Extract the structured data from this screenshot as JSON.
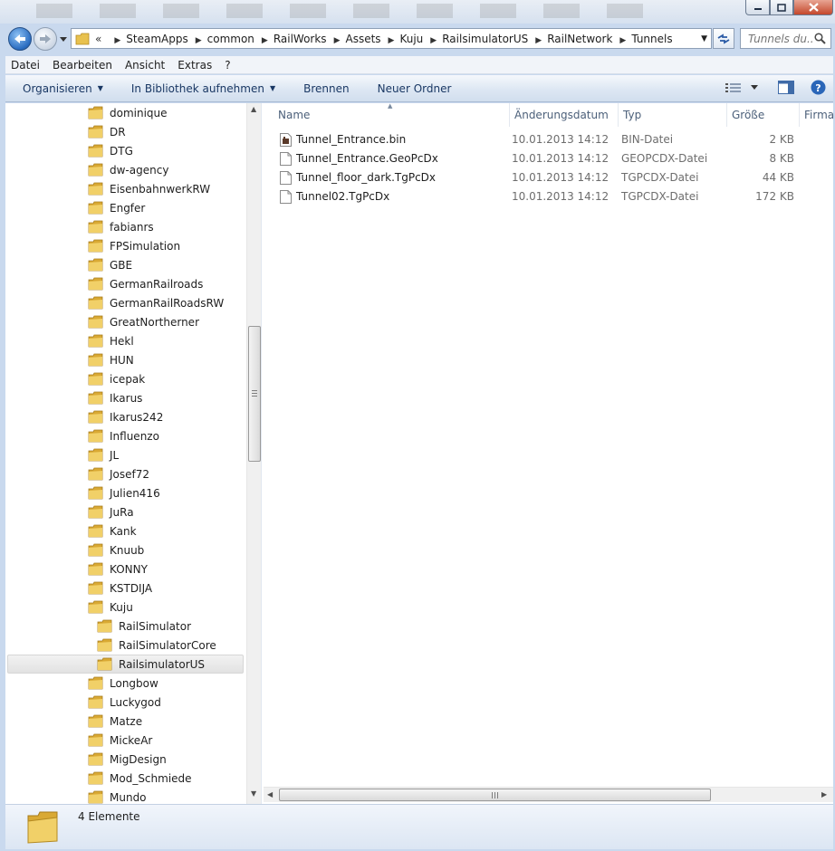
{
  "window": {
    "minimize_glyph": "—",
    "maximize_glyph": "□",
    "close_glyph": "✕"
  },
  "address": {
    "overflow": "«",
    "crumbs": [
      "SteamApps",
      "common",
      "RailWorks",
      "Assets",
      "Kuju",
      "RailsimulatorUS",
      "RailNetwork",
      "Tunnels"
    ],
    "chevron": "▶",
    "dropdown": "▼"
  },
  "search": {
    "placeholder": "Tunnels du..."
  },
  "menu": [
    "Datei",
    "Bearbeiten",
    "Ansicht",
    "Extras",
    "?"
  ],
  "commands": {
    "organize": "Organisieren",
    "library": "In Bibliothek aufnehmen",
    "burn": "Brennen",
    "new_folder": "Neuer Ordner",
    "caret": "▼"
  },
  "tree": [
    {
      "label": "dominique",
      "level": 0
    },
    {
      "label": "DR",
      "level": 0
    },
    {
      "label": "DTG",
      "level": 0
    },
    {
      "label": "dw-agency",
      "level": 0
    },
    {
      "label": "EisenbahnwerkRW",
      "level": 0
    },
    {
      "label": "Engfer",
      "level": 0
    },
    {
      "label": "fabianrs",
      "level": 0
    },
    {
      "label": "FPSimulation",
      "level": 0
    },
    {
      "label": "GBE",
      "level": 0
    },
    {
      "label": "GermanRailroads",
      "level": 0
    },
    {
      "label": "GermanRailRoadsRW",
      "level": 0
    },
    {
      "label": "GreatNortherner",
      "level": 0
    },
    {
      "label": "Hekl",
      "level": 0
    },
    {
      "label": "HUN",
      "level": 0
    },
    {
      "label": "icepak",
      "level": 0
    },
    {
      "label": "Ikarus",
      "level": 0
    },
    {
      "label": "Ikarus242",
      "level": 0
    },
    {
      "label": "Influenzo",
      "level": 0
    },
    {
      "label": "JL",
      "level": 0
    },
    {
      "label": "Josef72",
      "level": 0
    },
    {
      "label": "Julien416",
      "level": 0
    },
    {
      "label": "JuRa",
      "level": 0
    },
    {
      "label": "Kank",
      "level": 0
    },
    {
      "label": "Knuub",
      "level": 0
    },
    {
      "label": "KONNY",
      "level": 0
    },
    {
      "label": "KSTDIJA",
      "level": 0
    },
    {
      "label": "Kuju",
      "level": 0
    },
    {
      "label": "RailSimulator",
      "level": 1
    },
    {
      "label": "RailSimulatorCore",
      "level": 1
    },
    {
      "label": "RailsimulatorUS",
      "level": 1,
      "selected": true
    },
    {
      "label": "Longbow",
      "level": 0
    },
    {
      "label": "Luckygod",
      "level": 0
    },
    {
      "label": "Matze",
      "level": 0
    },
    {
      "label": "MickeAr",
      "level": 0
    },
    {
      "label": "MigDesign",
      "level": 0
    },
    {
      "label": "Mod_Schmiede",
      "level": 0
    },
    {
      "label": "Mundo",
      "level": 0
    }
  ],
  "columns": {
    "name": "Name",
    "date": "Änderungsdatum",
    "type": "Typ",
    "size": "Größe",
    "company": "Firma",
    "sort_glyph": "▲"
  },
  "files": [
    {
      "name": "Tunnel_Entrance.bin",
      "date": "10.01.2013 14:12",
      "type": "BIN-Datei",
      "size": "2 KB",
      "icon": "binary-file-icon"
    },
    {
      "name": "Tunnel_Entrance.GeoPcDx",
      "date": "10.01.2013 14:12",
      "type": "GEOPCDX-Datei",
      "size": "8 KB",
      "icon": "blank-file-icon"
    },
    {
      "name": "Tunnel_floor_dark.TgPcDx",
      "date": "10.01.2013 14:12",
      "type": "TGPCDX-Datei",
      "size": "44 KB",
      "icon": "blank-file-icon"
    },
    {
      "name": "Tunnel02.TgPcDx",
      "date": "10.01.2013 14:12",
      "type": "TGPCDX-Datei",
      "size": "172 KB",
      "icon": "blank-file-icon"
    }
  ],
  "scroll": {
    "up": "▲",
    "down": "▼",
    "left": "◀",
    "right": "▶"
  },
  "status": {
    "count": "4 Elemente"
  },
  "colors": {
    "folder": "#e8c14e",
    "accent": "#1a3864",
    "selection": "#e2e2e2"
  }
}
